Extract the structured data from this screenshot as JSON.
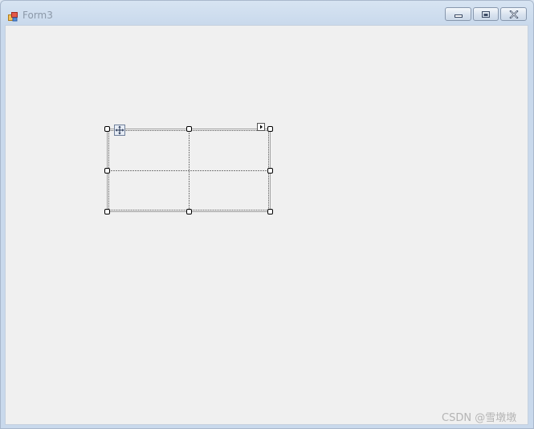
{
  "window": {
    "title": "Form3",
    "icon": "form-app-icon",
    "caption_buttons": [
      "minimize-icon",
      "maximize-icon",
      "close-icon"
    ]
  },
  "designer": {
    "selected_control": "table-layout-panel",
    "columns": 2,
    "rows": 2,
    "glyphs": [
      "move-glyph-icon",
      "smart-tag-icon"
    ]
  },
  "watermark": {
    "text": "CSDN @雪墩墩"
  },
  "colors": {
    "client_background": "#f0f0f0",
    "title_text": "#8b98a8",
    "frame": "#c9d9ec",
    "grid_line": "#7a7a7a"
  }
}
